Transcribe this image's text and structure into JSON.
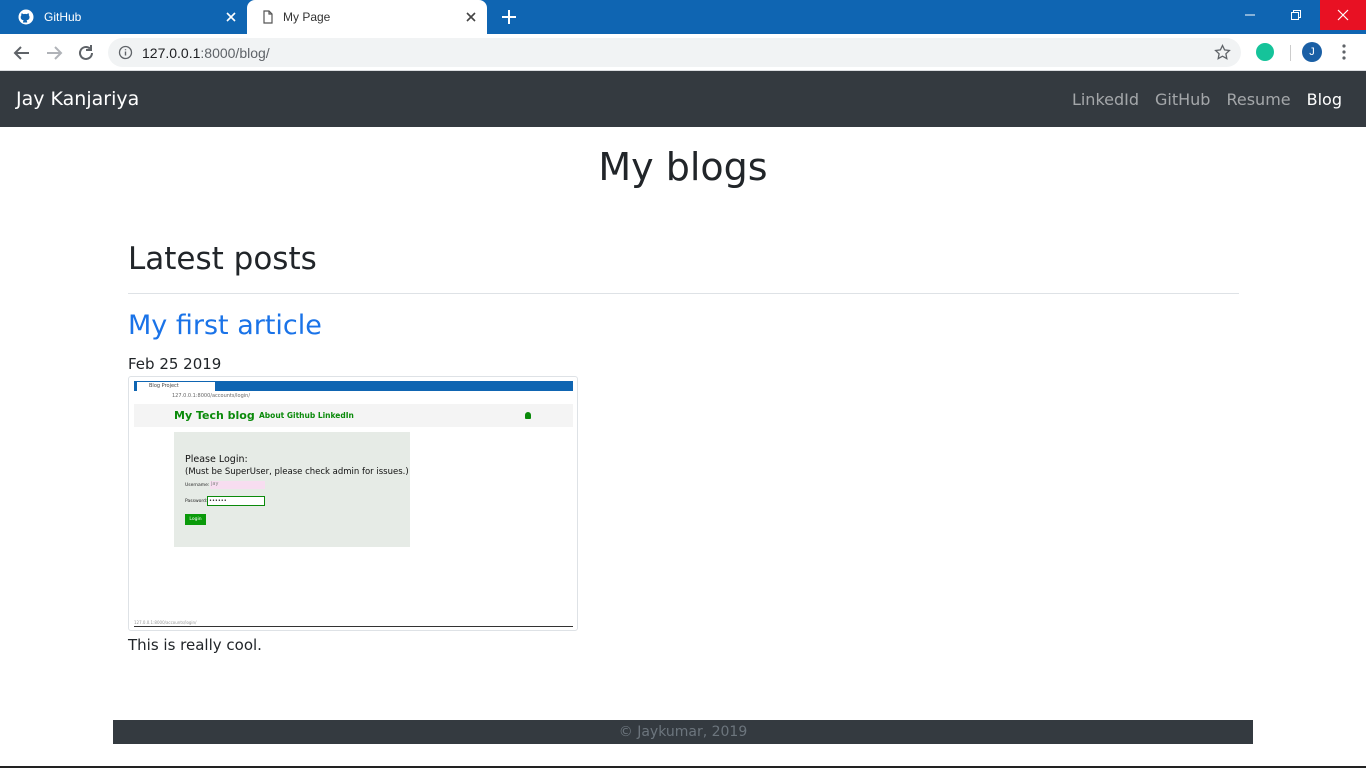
{
  "browser": {
    "tabs": [
      {
        "title": "GitHub",
        "active": false
      },
      {
        "title": "My Page",
        "active": true
      }
    ],
    "url_host": "127.0.0.1",
    "url_path": ":8000/blog/",
    "profile_initial": "J"
  },
  "site": {
    "brand": "Jay Kanjariya",
    "nav": [
      "LinkedId",
      "GitHub",
      "Resume",
      "Blog"
    ],
    "active_nav": "Blog"
  },
  "main": {
    "page_title": "My blogs",
    "section_title": "Latest posts",
    "post": {
      "title": "My first article",
      "date": "Feb 25 2019",
      "body": "This is really cool."
    }
  },
  "screenshot": {
    "tab_title": "Blog Project",
    "url": "127.0.0.1:8000/accounts/login/",
    "brand": "My Tech blog",
    "links": "About  Github  LinkedIn",
    "heading": "Please Login:",
    "subheading": "(Must be SuperUser, please check admin for issues.)",
    "username_label": "Username:",
    "username_value": "jay",
    "password_label": "Password:",
    "password_value": "••••••",
    "button": "Login",
    "status": "127.0.0.1:8000/accounts/login/"
  },
  "footer": {
    "text": "© Jaykumar, 2019"
  },
  "colors": {
    "navbar": "#343a40",
    "link": "#1a73e8",
    "chrome": "#0f65b2"
  }
}
